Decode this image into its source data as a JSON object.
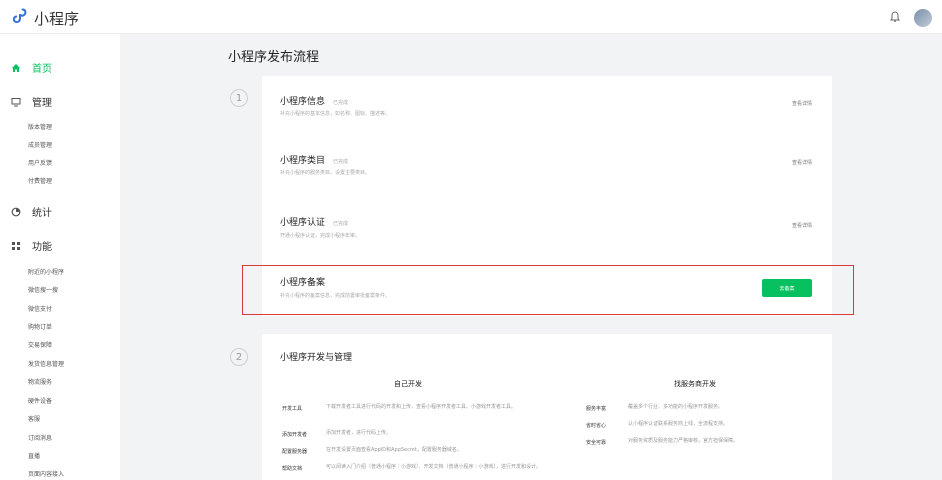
{
  "app": {
    "name": "小程序"
  },
  "sidebar": {
    "home": "首页",
    "manage": "管理",
    "manage_items": [
      "版本管理",
      "成员管理",
      "用户反馈",
      "付费管理"
    ],
    "stats": "统计",
    "features": "功能",
    "feature_items": [
      "附近的小程序",
      "微信搜一搜",
      "微信支付",
      "购物订单",
      "交易保障",
      "发货信息管理",
      "物流服务",
      "硬件设备",
      "客服",
      "订阅消息",
      "直播",
      "页面内容接入"
    ]
  },
  "main": {
    "title": "小程序发布流程",
    "steps": [
      "1",
      "2"
    ],
    "section1": {
      "rows": [
        {
          "title": "小程序信息",
          "tag": "已完成",
          "desc": "补充小程序的基本信息，如名称、图标、描述等。",
          "action": "查看详情"
        },
        {
          "title": "小程序类目",
          "tag": "已完成",
          "desc": "补充小程序的服务类目，设置主要类目。",
          "action": "查看详情"
        },
        {
          "title": "小程序认证",
          "tag": "已完成",
          "desc": "开通小程序认证，完成小程序年审。",
          "action": "查看详情"
        },
        {
          "title": "小程序备案",
          "tag": "",
          "desc": "补充小程序的备案信息，完成前置审批备案条件。",
          "action": "去备案"
        }
      ]
    },
    "section2": {
      "title": "小程序开发与管理",
      "col_self": "自己开发",
      "col_vendor": "找服务商开发",
      "self_rows": [
        {
          "label": "开发工具",
          "desc": "下载开发者工具进行代码的开发和上传，查看小程序开发者工具、小游戏开发者工具。"
        },
        {
          "label": "添加开发者",
          "desc": "添加开发者，进行代码上传。"
        },
        {
          "label": "配置服务器",
          "desc": "在开发设置页面查看AppID和AppSecret，配置服务器域名。"
        },
        {
          "label": "帮助文档",
          "desc": "可以阅读入门介绍（普通小程序｜小游戏）、开发文档（普通小程序｜小游戏），进行开发和设计。"
        }
      ],
      "vendor_rows": [
        {
          "label": "服务丰富",
          "desc": "覆盖多个行业、多功能的小程序开发服务。"
        },
        {
          "label": "省时省心",
          "desc": "认小程序认证联系服务商上线，全流程支持。"
        },
        {
          "label": "安全可靠",
          "desc": "对服务资质及服务能力严格审核，官方担保保障。"
        }
      ]
    }
  }
}
